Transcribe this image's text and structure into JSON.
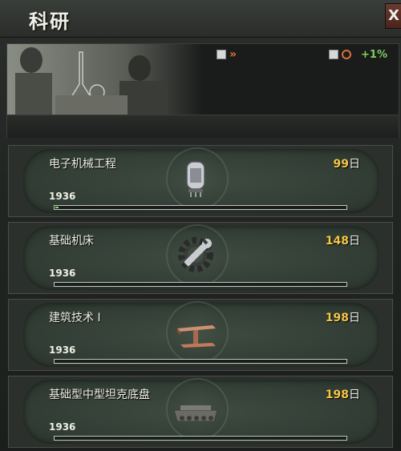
{
  "window": {
    "title": "科研",
    "close_label": "X"
  },
  "header": {
    "stat_speed": {
      "icon": "research-doc-arrow-icon",
      "value": ""
    },
    "stat_bonus": {
      "icon": "research-clock-icon",
      "value": "+1%"
    }
  },
  "colors": {
    "days_accent": "#f5c842",
    "bonus_green": "#7fce5e",
    "progress_green": "#7fe06a"
  },
  "slots": [
    {
      "name": "电子机械工程",
      "days": "99",
      "days_unit": "日",
      "year": "1936",
      "progress": 0.01,
      "icon": "vacuum-tube-icon"
    },
    {
      "name": "基础机床",
      "days": "148",
      "days_unit": "日",
      "year": "1936",
      "progress": 0,
      "icon": "wrench-gear-icon"
    },
    {
      "name": "建筑技术 I",
      "days": "198",
      "days_unit": "日",
      "year": "1936",
      "progress": 0,
      "icon": "steel-beam-icon"
    },
    {
      "name": "基础型中型坦克底盘",
      "days": "198",
      "days_unit": "日",
      "year": "1936",
      "progress": 0,
      "icon": "tank-chassis-icon"
    }
  ]
}
